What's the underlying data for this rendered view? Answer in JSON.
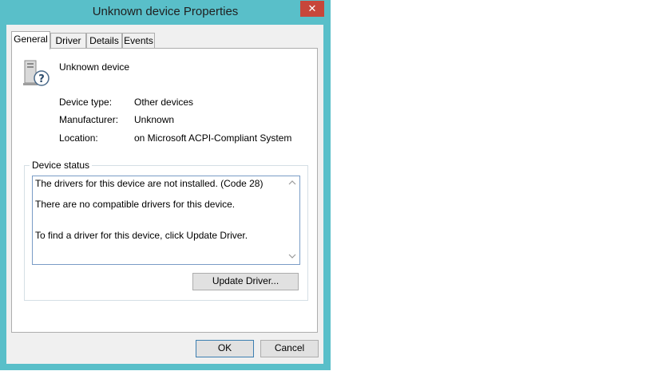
{
  "window": {
    "title": "Unknown device Properties",
    "close_glyph": "✕"
  },
  "tabs": [
    {
      "label": "General",
      "active": true
    },
    {
      "label": "Driver",
      "active": false
    },
    {
      "label": "Details",
      "active": false
    },
    {
      "label": "Events",
      "active": false
    }
  ],
  "device": {
    "name": "Unknown device",
    "icon": "unknown-device-icon",
    "properties": [
      {
        "label": "Device type:",
        "value": "Other devices"
      },
      {
        "label": "Manufacturer:",
        "value": "Unknown"
      },
      {
        "label": "Location:",
        "value": "on Microsoft ACPI-Compliant System"
      }
    ]
  },
  "status": {
    "group_title": "Device status",
    "lines": [
      "The drivers for this device are not installed. (Code 28)",
      "There are no compatible drivers for this device.",
      "To find a driver for this device, click Update Driver."
    ],
    "update_driver_label": "Update Driver..."
  },
  "footer": {
    "ok_label": "OK",
    "cancel_label": "Cancel"
  },
  "colors": {
    "frame": "#59bfc9",
    "close": "#c7473b"
  }
}
